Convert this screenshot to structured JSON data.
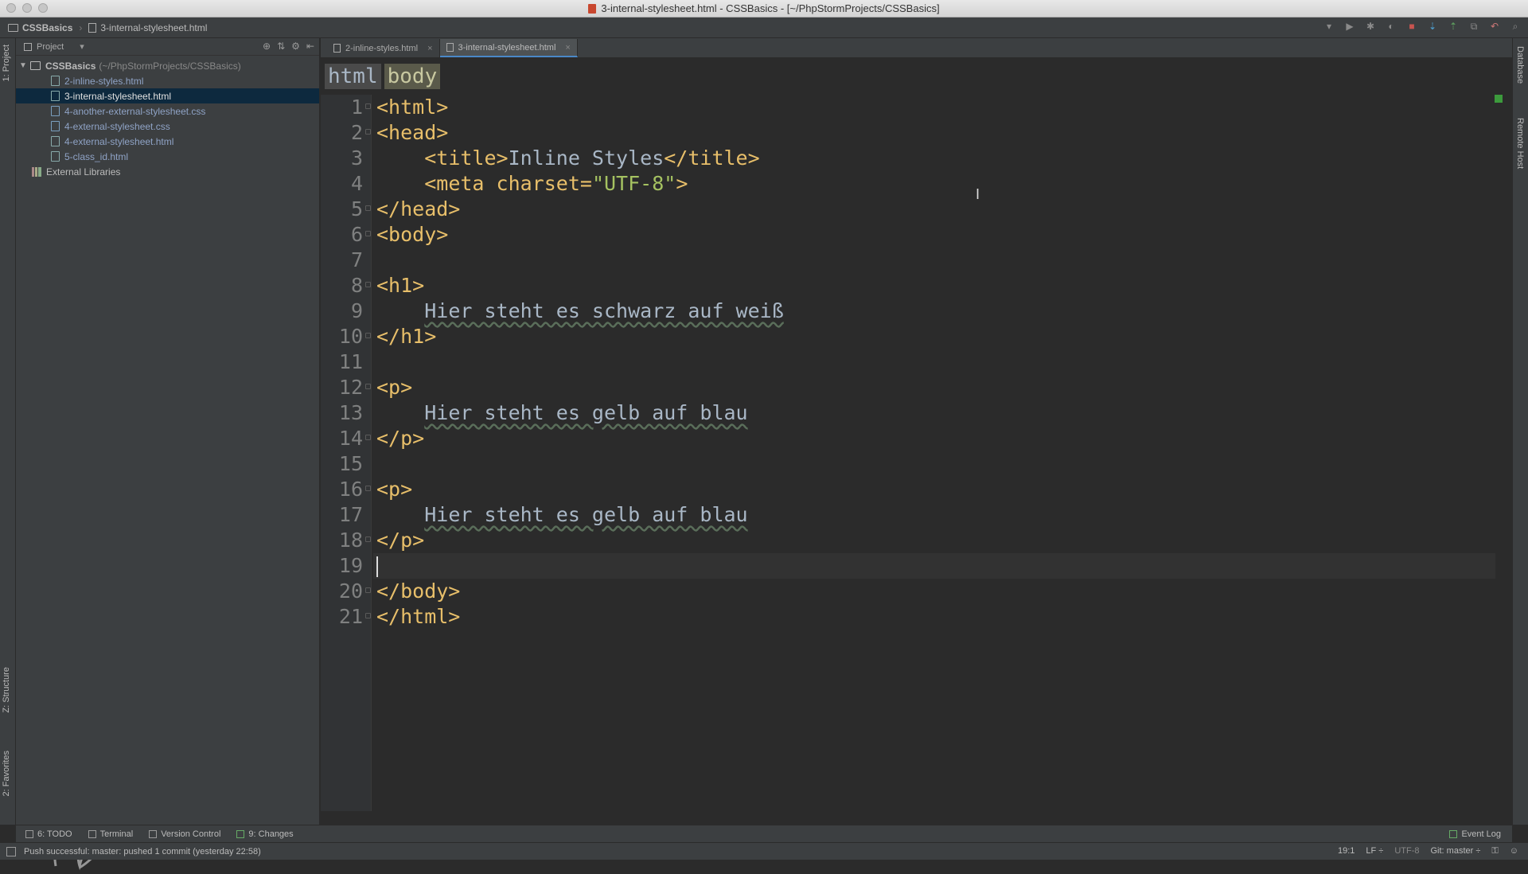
{
  "window": {
    "title": "3-internal-stylesheet.html - CSSBasics - [~/PhpStormProjects/CSSBasics]"
  },
  "navbar": {
    "crumbs": [
      "CSSBasics",
      "3-internal-stylesheet.html"
    ]
  },
  "left_strip": {
    "project_label": "1: Project",
    "structure_label": "Z: Structure",
    "favorites_label": "2: Favorites"
  },
  "right_strip": {
    "database_label": "Database",
    "remote_host_label": "Remote Host"
  },
  "project_panel": {
    "header": "Project",
    "root": {
      "name": "CSSBasics",
      "path": "(~/PhpStormProjects/CSSBasics)"
    },
    "files": [
      {
        "name": "2-inline-styles.html",
        "type": "html",
        "selected": false
      },
      {
        "name": "3-internal-stylesheet.html",
        "type": "html",
        "selected": true
      },
      {
        "name": "4-another-external-stylesheet.css",
        "type": "css",
        "selected": false
      },
      {
        "name": "4-external-stylesheet.css",
        "type": "css",
        "selected": false
      },
      {
        "name": "4-external-stylesheet.html",
        "type": "html",
        "selected": false
      },
      {
        "name": "5-class_id.html",
        "type": "html",
        "selected": false
      }
    ],
    "libraries": "External Libraries"
  },
  "editor_tabs": [
    {
      "label": "2-inline-styles.html",
      "active": false
    },
    {
      "label": "3-internal-stylesheet.html",
      "active": true
    }
  ],
  "editor_breadcrumb": [
    "html",
    "body"
  ],
  "editor": {
    "current_line": 19,
    "lines": [
      "1",
      "2",
      "3",
      "4",
      "5",
      "6",
      "7",
      "8",
      "9",
      "10",
      "11",
      "12",
      "13",
      "14",
      "15",
      "16",
      "17",
      "18",
      "19",
      "20",
      "21"
    ],
    "code": {
      "l1": "<html>",
      "l2": "<head>",
      "l3_open": "<title>",
      "l3_text": "Inline Styles",
      "l3_close": "</title>",
      "l4_tag": "<meta ",
      "l4_attr": "charset=",
      "l4_val": "\"UTF-8\"",
      "l4_end": ">",
      "l5": "</head>",
      "l6": "<body>",
      "l8": "<h1>",
      "l9": "Hier steht es schwarz auf weiß",
      "l10": "</h1>",
      "l12": "<p>",
      "l13": "Hier steht es gelb auf blau",
      "l14": "</p>",
      "l16": "<p>",
      "l17": "Hier steht es gelb auf blau",
      "l18": "</p>",
      "l20": "</body>",
      "l21": "</html>"
    }
  },
  "bottom_tools": {
    "todo": "6: TODO",
    "terminal": "Terminal",
    "vcs": "Version Control",
    "changes": "9: Changes",
    "event_log": "Event Log"
  },
  "status": {
    "message": "Push successful: master: pushed 1 commit (yesterday 22:58)",
    "position": "19:1",
    "line_sep": "LF ÷",
    "encoding": "UTF-8",
    "git": "Git: master ÷"
  }
}
